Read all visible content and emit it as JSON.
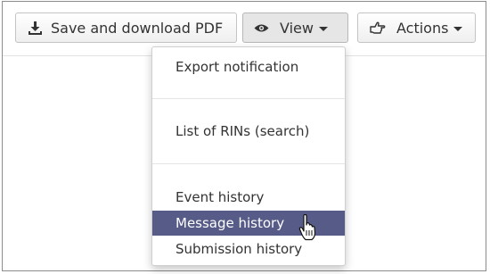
{
  "toolbar": {
    "save_label": "Save and download PDF",
    "view_label": "View",
    "actions_label": "Actions"
  },
  "icons": {
    "save": "download-icon",
    "view": "eye-icon",
    "actions": "hand-point-icon"
  },
  "view_menu": {
    "items": [
      "Export notification",
      "List of RINs (search)",
      "Event history",
      "Message history",
      "Submission history"
    ],
    "highlighted": "Message history"
  },
  "colors": {
    "highlight": "#565b88",
    "text": "#333333"
  }
}
